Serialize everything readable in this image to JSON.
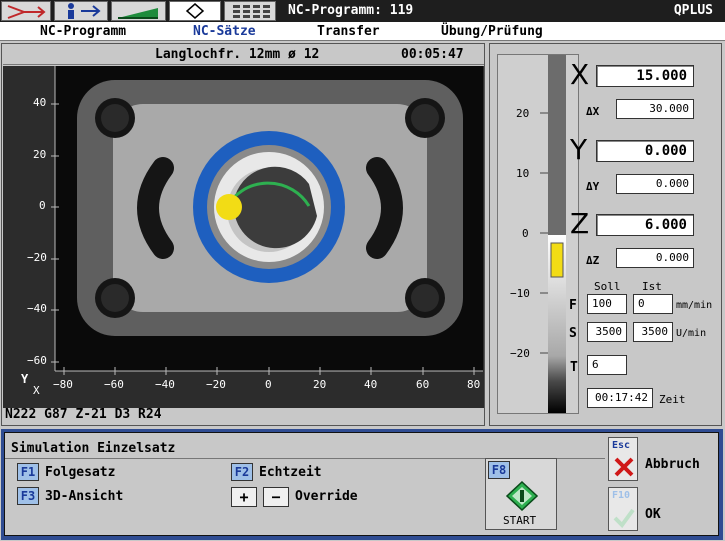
{
  "toolbar": {
    "program_label": "NC-Programm: 119",
    "brand": "QPLUS"
  },
  "menu": {
    "items": [
      {
        "label": "NC-Programm",
        "active": false
      },
      {
        "label": "NC-Sätze",
        "active": true
      },
      {
        "label": "Transfer",
        "active": false
      },
      {
        "label": "Übung/Prüfung",
        "active": false
      }
    ]
  },
  "simulation": {
    "title": "Langlochfr. 12mm ø 12",
    "time": "00:05:47",
    "y_ticks": [
      "40",
      "20",
      "0",
      "−20",
      "−40",
      "−60"
    ],
    "x_ticks": [
      "−80",
      "−60",
      "−40",
      "−20",
      "0",
      "20",
      "40",
      "60",
      "80"
    ],
    "axis_y": "Y",
    "axis_x": "X",
    "nc_line": "N222 G87 Z-21 D3 R24"
  },
  "dro": {
    "scale_ticks": [
      "20",
      "10",
      "0",
      "−10",
      "−20"
    ],
    "x": {
      "label": "X",
      "value": "15.000",
      "delta_label": "ΔX",
      "delta_value": "30.000"
    },
    "y": {
      "label": "Y",
      "value": "0.000",
      "delta_label": "ΔY",
      "delta_value": "0.000"
    },
    "z": {
      "label": "Z",
      "value": "6.000",
      "delta_label": "ΔZ",
      "delta_value": "0.000"
    },
    "soll_label": "Soll",
    "ist_label": "Ist",
    "f": {
      "label": "F",
      "soll": "100",
      "ist": "0",
      "unit": "mm/min"
    },
    "s": {
      "label": "S",
      "soll": "3500",
      "ist": "3500",
      "unit": "U/min"
    },
    "t": {
      "label": "T",
      "value": "6"
    },
    "zeit_value": "00:17:42",
    "zeit_label": "Zeit"
  },
  "dialog": {
    "title": "Simulation Einzelsatz",
    "f1": {
      "key": "F1",
      "label": "Folgesatz"
    },
    "f2": {
      "key": "F2",
      "label": "Echtzeit"
    },
    "f3": {
      "key": "F3",
      "label": "3D-Ansicht"
    },
    "override_label": "Override",
    "plus": "+",
    "minus": "−",
    "f8": {
      "key": "F8",
      "label": "START"
    },
    "esc": {
      "key": "Esc",
      "label": "Abbruch"
    },
    "f10": {
      "key": "F10",
      "label": "OK"
    }
  }
}
